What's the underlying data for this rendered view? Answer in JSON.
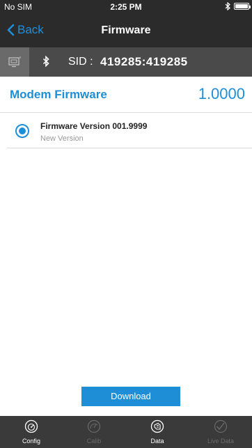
{
  "status_bar": {
    "carrier": "No SIM",
    "time": "2:25 PM"
  },
  "nav": {
    "back_label": "Back",
    "title": "Firmware"
  },
  "sid_bar": {
    "label": "SID :",
    "value": "419285:419285"
  },
  "modem": {
    "label": "Modem Firmware",
    "version": "1.0000"
  },
  "firmware_list": [
    {
      "title": "Firmware Version 001.9999",
      "subtitle": "New Version",
      "selected": true
    }
  ],
  "download_label": "Download",
  "tabs": [
    {
      "label": "Config",
      "icon": "gauge-icon",
      "enabled": true
    },
    {
      "label": "Calib",
      "icon": "dial-icon",
      "enabled": false
    },
    {
      "label": "Data",
      "icon": "data-icon",
      "enabled": true
    },
    {
      "label": "Live Data",
      "icon": "live-data-icon",
      "enabled": false
    }
  ],
  "colors": {
    "accent": "#1e8fd6",
    "bar_dark": "#2b2b2b",
    "sid_bar": "#4a4a4a",
    "tab_bar": "#3a3a3a"
  }
}
